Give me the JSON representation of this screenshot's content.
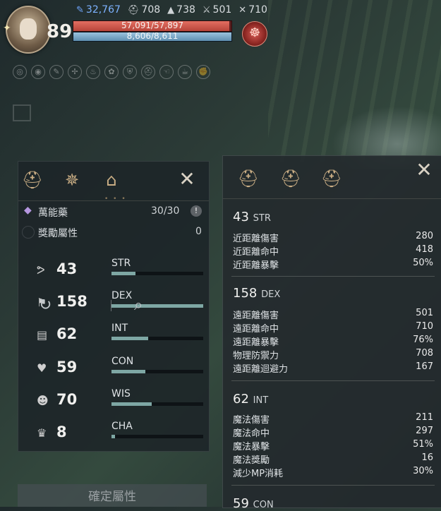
{
  "hud": {
    "level": "89",
    "stats": [
      {
        "icon": "feather-icon",
        "glyph": "✎",
        "value": "32,767"
      },
      {
        "icon": "helmet-icon",
        "glyph": "⛑",
        "value": "708"
      },
      {
        "icon": "witch-hat-icon",
        "glyph": "▲",
        "value": "738"
      },
      {
        "icon": "crossed-swords-icon",
        "glyph": "⚔",
        "value": "501"
      },
      {
        "icon": "crossed-bows-icon",
        "glyph": "✕",
        "value": "710"
      }
    ],
    "hp_text": "57,091/57,897",
    "mp_text": "8,606/8,611",
    "hp_fraction": 0.986,
    "mp_fraction": 0.999,
    "toolbar_icons": [
      "ring-icon",
      "eye-icon",
      "feather-icon",
      "eagle-icon",
      "fire-icon",
      "grain-icon",
      "shield-icon",
      "helmet-icon",
      "hand-icon",
      "cup-icon",
      "fist-icon"
    ]
  },
  "left_panel": {
    "tabs": [
      "helmet-tab-icon",
      "star-compass-tab-icon",
      "house-tab-icon"
    ],
    "close_glyph": "✕",
    "elixir": {
      "label": "萬能藥",
      "value": "30/30",
      "info": "!"
    },
    "bonus": {
      "label": "獎勵屬性",
      "value": "0"
    },
    "stats": [
      {
        "name": "STR",
        "value": "43",
        "icon": "arm-icon",
        "glyph": "💪",
        "fill": 0.26
      },
      {
        "name": "DEX",
        "value": "158",
        "icon": "boot-icon",
        "glyph": "👢",
        "fill": 1.0
      },
      {
        "name": "INT",
        "value": "62",
        "icon": "book-icon",
        "glyph": "📖",
        "fill": 0.4
      },
      {
        "name": "CON",
        "value": "59",
        "icon": "heart-icon",
        "glyph": "❤",
        "fill": 0.37
      },
      {
        "name": "WIS",
        "value": "70",
        "icon": "head-icon",
        "glyph": "☻",
        "fill": 0.44
      },
      {
        "name": "CHA",
        "value": "8",
        "icon": "crown-icon",
        "glyph": "♛",
        "fill": 0.04
      }
    ],
    "confirm_label": "確定屬性",
    "accent": "#7ea7a4"
  },
  "right_panel": {
    "close_glyph": "✕",
    "sections": [
      {
        "value": "43",
        "abbr": "STR",
        "rows": [
          [
            "近距離傷害",
            "280"
          ],
          [
            "近距離命中",
            "418"
          ],
          [
            "近距離暴擊",
            "50%"
          ]
        ]
      },
      {
        "value": "158",
        "abbr": "DEX",
        "rows": [
          [
            "遠距離傷害",
            "501"
          ],
          [
            "遠距離命中",
            "710"
          ],
          [
            "遠距離暴擊",
            "76%"
          ],
          [
            "物理防禦力",
            "708"
          ],
          [
            "遠距離迴避力",
            "167"
          ]
        ]
      },
      {
        "value": "62",
        "abbr": "INT",
        "rows": [
          [
            "魔法傷害",
            "211"
          ],
          [
            "魔法命中",
            "297"
          ],
          [
            "魔法暴擊",
            "51%"
          ],
          [
            "魔法獎勵",
            "16"
          ],
          [
            "減少MP消耗",
            "30%"
          ]
        ]
      },
      {
        "value": "59",
        "abbr": "CON",
        "rows": []
      }
    ]
  }
}
